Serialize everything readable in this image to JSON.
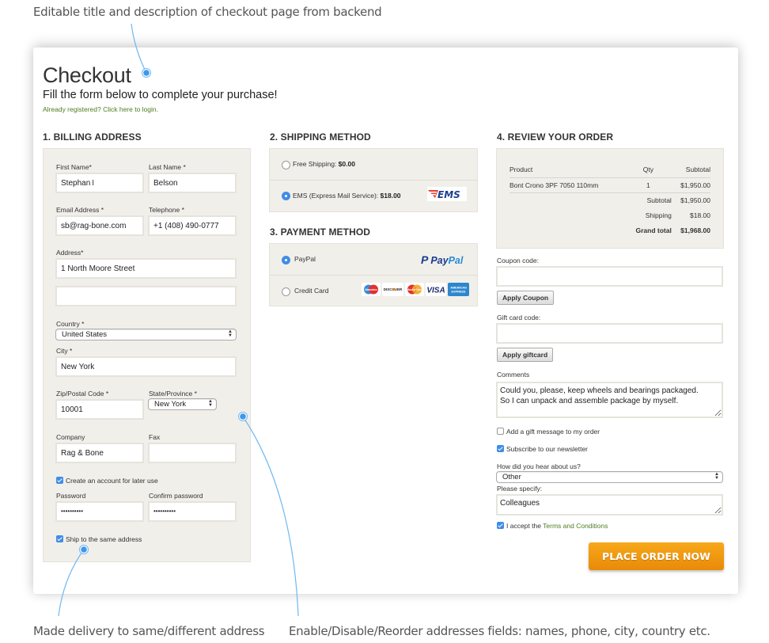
{
  "annotations": {
    "top": "Editable title and description of checkout page from backend",
    "bottom_left": "Made delivery to same/different address",
    "bottom_right": "Enable/Disable/Reorder addresses fields: names, phone, city, country etc."
  },
  "header": {
    "title": "Checkout",
    "subtitle": "Fill the form below to complete your purchase!",
    "login_link": "Already registered? Click here to login."
  },
  "billing": {
    "section_title": "1. BILLING ADDRESS",
    "first_name": {
      "label": "First Name*",
      "value": "Stephan"
    },
    "last_name": {
      "label": "Last Name *",
      "value": "Belson"
    },
    "email": {
      "label": "Email Address *",
      "value": "sb@rag-bone.com"
    },
    "telephone": {
      "label": "Telephone *",
      "value": "+1 (408) 490-0777"
    },
    "address": {
      "label": "Address*",
      "line1": "1 North Moore Street",
      "line2": ""
    },
    "country": {
      "label": "Country *",
      "value": "United States"
    },
    "city": {
      "label": "City *",
      "value": "New York"
    },
    "zip": {
      "label": "Zip/Postal Code *",
      "value": "10001"
    },
    "state": {
      "label": "State/Province *",
      "value": "New York"
    },
    "company": {
      "label": "Company",
      "value": "Rag & Bone"
    },
    "fax": {
      "label": "Fax",
      "value": ""
    },
    "create_account": {
      "label": "Create an account for later use",
      "checked": true
    },
    "password": {
      "label": "Password",
      "value": "••••••••••"
    },
    "confirm_password": {
      "label": "Confirm password",
      "value": "••••••••••"
    },
    "ship_same": {
      "label": "Ship to the same address",
      "checked": true
    }
  },
  "shipping": {
    "section_title": "2. SHIPPING METHOD",
    "options": [
      {
        "label": "Free Shipping: ",
        "price": "$0.00",
        "selected": false
      },
      {
        "label": "EMS (Express Mail Service): ",
        "price": "$18.00",
        "selected": true,
        "logo": "EMS"
      }
    ]
  },
  "payment": {
    "section_title": "3. PAYMENT METHOD",
    "options": [
      {
        "label": "PayPal",
        "selected": true,
        "logo": "PayPal"
      },
      {
        "label": "Credit Card",
        "selected": false,
        "cards": [
          "Maestro",
          "DISCOVER",
          "MasterCard",
          "VISA",
          "AMERICAN EXPRESS"
        ]
      }
    ]
  },
  "review": {
    "section_title": "4. REVIEW YOUR ORDER",
    "columns": [
      "Product",
      "Qty",
      "Subtotal"
    ],
    "items": [
      {
        "product": "Bont Crono 3PF 7050 110mm",
        "qty": "1",
        "subtotal": "$1,950.00"
      }
    ],
    "totals": [
      {
        "label": "Subtotal",
        "value": "$1,950.00"
      },
      {
        "label": "Shipping",
        "value": "$18.00"
      },
      {
        "label": "Grand total",
        "value": "$1,968.00"
      }
    ],
    "coupon": {
      "label": "Coupon code:",
      "value": "",
      "button": "Apply Coupon"
    },
    "giftcard": {
      "label": "Gift card code:",
      "value": "",
      "button": "Apply giftcard"
    },
    "comments": {
      "label": "Comments",
      "value": "Could you, please, keep wheels and bearings packaged.\nSo I can unpack and assemble package by myself."
    },
    "gift_message": {
      "label": "Add a gift message to my order",
      "checked": false
    },
    "newsletter": {
      "label": "Subscribe to our newsletter",
      "checked": true
    },
    "hear_about": {
      "label": "How did you hear about us?",
      "value": "Other"
    },
    "specify": {
      "label": "Please specify:",
      "value": "Colleagues"
    },
    "terms": {
      "prefix": "I accept the ",
      "link": "Terms and Conditions",
      "checked": true
    },
    "place_order": "PLACE ORDER NOW"
  },
  "colors": {
    "accent_blue": "#3f8de6",
    "link_green": "#4e7d1f",
    "order_button": "#f09a12",
    "panel_bg": "#f1efea"
  }
}
